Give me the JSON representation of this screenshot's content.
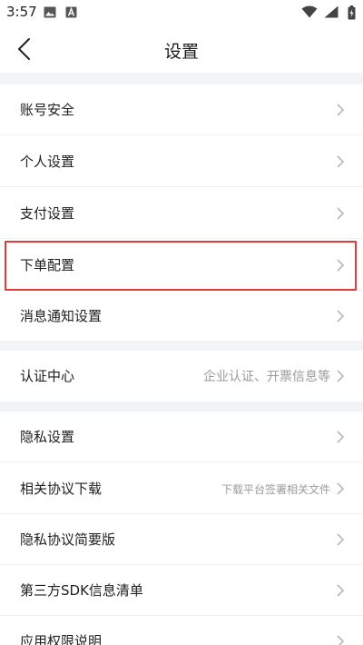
{
  "status": {
    "time": "3:57"
  },
  "nav": {
    "title": "设置"
  },
  "rows": [
    {
      "label": "账号安全",
      "value": ""
    },
    {
      "label": "个人设置",
      "value": ""
    },
    {
      "label": "支付设置",
      "value": ""
    },
    {
      "label": "下单配置",
      "value": ""
    },
    {
      "label": "消息通知设置",
      "value": ""
    },
    {
      "label": "认证中心",
      "value": "企业认证、开票信息等"
    },
    {
      "label": "隐私设置",
      "value": ""
    },
    {
      "label": "相关协议下载",
      "value": "下载平台签署相关文件"
    },
    {
      "label": "隐私协议简要版",
      "value": ""
    },
    {
      "label": "第三方SDK信息清单",
      "value": ""
    },
    {
      "label": "应用权限说明",
      "value": ""
    }
  ],
  "colors": {
    "highlight": "#e23a3a",
    "section_gap": "#f3f4f6",
    "chevron": "#b8b8b8"
  }
}
